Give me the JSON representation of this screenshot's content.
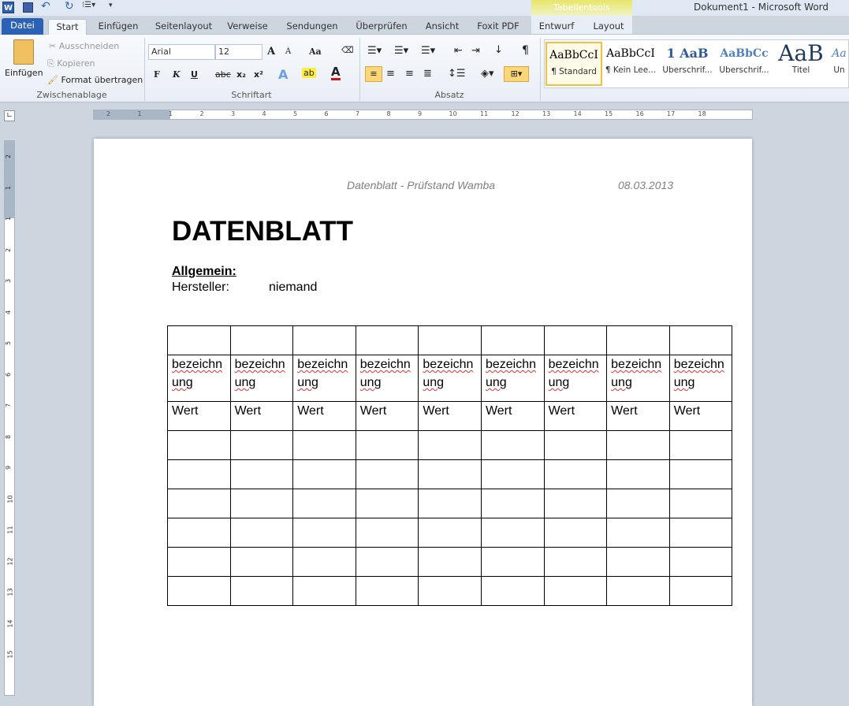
{
  "window": {
    "title": "Dokument1  -  Microsoft Word",
    "context_tab_group": "Tabellentools"
  },
  "quick_access": {
    "icons": [
      "word-logo-icon",
      "save-icon",
      "undo-icon",
      "redo-icon",
      "numbering-icon",
      "customize-icon"
    ]
  },
  "tabs": [
    {
      "label": "Datei"
    },
    {
      "label": "Start"
    },
    {
      "label": "Einfügen"
    },
    {
      "label": "Seitenlayout"
    },
    {
      "label": "Verweise"
    },
    {
      "label": "Sendungen"
    },
    {
      "label": "Überprüfen"
    },
    {
      "label": "Ansicht"
    },
    {
      "label": "Foxit PDF"
    },
    {
      "label": "Entwurf"
    },
    {
      "label": "Layout"
    }
  ],
  "ribbon": {
    "clipboard": {
      "label": "Zwischenablage",
      "paste": "Einfügen",
      "cut": "Ausschneiden",
      "copy": "Kopieren",
      "format_painter": "Format übertragen"
    },
    "font": {
      "label": "Schriftart",
      "font_name": "Arial",
      "font_size": "12",
      "bold": "F",
      "italic": "K",
      "underline": "U",
      "strike": "abc",
      "sub": "x₂",
      "sup": "x²",
      "case": "Aa",
      "grow": "A",
      "shrink": "A",
      "color": "A"
    },
    "paragraph": {
      "label": "Absatz",
      "pilcrow": "¶"
    },
    "styles": [
      {
        "preview": "AaBbCcI",
        "label": "¶ Standard"
      },
      {
        "preview": "AaBbCcI",
        "label": "¶ Kein Lee..."
      },
      {
        "preview": "1  AaB",
        "label": "Überschrif..."
      },
      {
        "preview": "AaBbCc",
        "label": "Überschrif..."
      },
      {
        "preview": "AaB",
        "label": "Titel"
      },
      {
        "preview": "Aa",
        "label": "Un"
      }
    ]
  },
  "ruler": {
    "h_labels": [
      "2",
      "1",
      "1",
      "2",
      "3",
      "4",
      "5",
      "6",
      "7",
      "8",
      "9",
      "10",
      "11",
      "12",
      "13",
      "14",
      "15",
      "16",
      "17",
      "18"
    ],
    "v_labels": [
      "2",
      "1",
      "1",
      "2",
      "3",
      "4",
      "5",
      "6",
      "7",
      "8",
      "9",
      "10",
      "11",
      "12",
      "13",
      "14",
      "15"
    ]
  },
  "document": {
    "header_left": "Datenblatt - Prüfstand Wamba",
    "header_right": "08.03.2013",
    "title": "DATENBLATT",
    "section": "Allgemein:",
    "field_label": "Hersteller:",
    "field_value": "niemand",
    "table": {
      "columns": 9,
      "rows": [
        [
          "",
          "",
          "",
          "",
          "",
          "",
          "",
          "",
          ""
        ],
        [
          "bezeichnung",
          "bezeichnung",
          "bezeichnung",
          "bezeichnung",
          "bezeichnung",
          "bezeichnung",
          "bezeichnung",
          "bezeichnung",
          "bezeichnung"
        ],
        [
          "Wert",
          "Wert",
          "Wert",
          "Wert",
          "Wert",
          "Wert",
          "Wert",
          "Wert",
          "Wert"
        ],
        [
          "",
          "",
          "",
          "",
          "",
          "",
          "",
          "",
          ""
        ],
        [
          "",
          "",
          "",
          "",
          "",
          "",
          "",
          "",
          ""
        ],
        [
          "",
          "",
          "",
          "",
          "",
          "",
          "",
          "",
          ""
        ],
        [
          "",
          "",
          "",
          "",
          "",
          "",
          "",
          "",
          ""
        ],
        [
          "",
          "",
          "",
          "",
          "",
          "",
          "",
          "",
          ""
        ],
        [
          "",
          "",
          "",
          "",
          "",
          "",
          "",
          "",
          ""
        ]
      ]
    }
  },
  "colors": {
    "file_tab": "#2b62b5",
    "context_tab": "#e7e66a",
    "spell_error": "#e03030"
  }
}
